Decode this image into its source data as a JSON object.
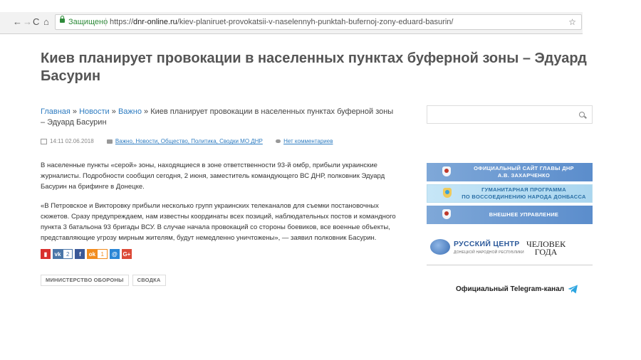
{
  "browser": {
    "back": "←",
    "forward": "→",
    "reload": "C",
    "home": "⌂",
    "secure_label": "Защищено",
    "url_scheme": "https://",
    "url_domain": "dnr-online.ru",
    "url_path": "/kiev-planiruet-provokatsii-v-naselennyh-punktah-bufernoj-zony-eduard-basurin/",
    "star": "☆"
  },
  "article": {
    "title": "Киев планирует провокации в населенных пунктах буферной зоны – Эдуард Басурин",
    "breadcrumbs": [
      {
        "label": "Главная"
      },
      {
        "label": "Новости"
      },
      {
        "label": "Важно"
      }
    ],
    "crumb_sep": " » ",
    "crumb_current": "Киев планирует провокации в населенных пунктах буферной зоны – Эдуард Басурин",
    "date": "14:11 02.06.2018",
    "categories": "Важно, Новости, Общество, Политика, Сводки МО ДНР",
    "comments": "Нет комментариев",
    "paragraphs": [
      "В населенные пункты «серой» зоны, находящиеся в зоне ответственности 93-й омбр, прибыли украинские журналисты. Подробности сообщил сегодня, 2 июня, заместитель командующего ВС ДНР, полковник Эдуард Басурин на брифинге в Донецке.",
      "«В Петровское и Викторовку прибыли несколько групп украинских телеканалов для съемки постановочных сюжетов. Сразу предупреждаем, нам известны координаты всех позиций, наблюдательных постов и командного пункта 3 батальона 93 бригады ВСУ. В случае начала провокаций со стороны боевиков, все военные объекты, представляющие угрозу мирным жителям, будут немедленно уничтожены», — заявил полковник Басурин."
    ],
    "share": [
      {
        "name": "bookmark",
        "glyph": "▮",
        "count": "",
        "color": "#d9302e"
      },
      {
        "name": "vk",
        "glyph": "vk",
        "count": "2",
        "color": "#4a76a8"
      },
      {
        "name": "facebook",
        "glyph": "f",
        "count": "",
        "color": "#3b5998"
      },
      {
        "name": "odnoklassniki",
        "glyph": "ok",
        "count": "1",
        "color": "#f28c1d"
      },
      {
        "name": "moimir",
        "glyph": "@",
        "count": "",
        "color": "#2a86d6"
      },
      {
        "name": "googleplus",
        "glyph": "G+",
        "count": "",
        "color": "#dc4a38"
      }
    ],
    "tags": [
      "МИНИСТЕРСТВО ОБОРОНЫ",
      "СВОДКА"
    ]
  },
  "sidebar": {
    "search_placeholder": "",
    "banners": [
      {
        "line1": "ОФИЦИАЛЬНЫЙ САЙТ ГЛАВЫ ДНР",
        "line2": "А.В. ЗАХАРЧЕНКО"
      },
      {
        "line1": "ГУМАНИТАРНАЯ ПРОГРАММА",
        "line2": "ПО ВОССОЕДИНЕНИЮ НАРОДА ДОНБАССА"
      },
      {
        "line1": "ВНЕШНЕЕ УПРАВЛЕНИЕ",
        "line2": ""
      }
    ],
    "russian_center": {
      "name": "РУССКИЙ ЦЕНТР",
      "subtitle": "ДОНЕЦКОЙ НАРОДНОЙ РЕСПУБЛИКИ"
    },
    "person_of_year": {
      "line1": "ЧЕЛОВЕК",
      "line2": "ГОДА"
    },
    "telegram_label": "Официальный Telegram-канал"
  },
  "colors": {
    "link": "#2e7cc1",
    "banner_blue": "#5b8dcc",
    "secure_green": "#2e8b3a"
  }
}
